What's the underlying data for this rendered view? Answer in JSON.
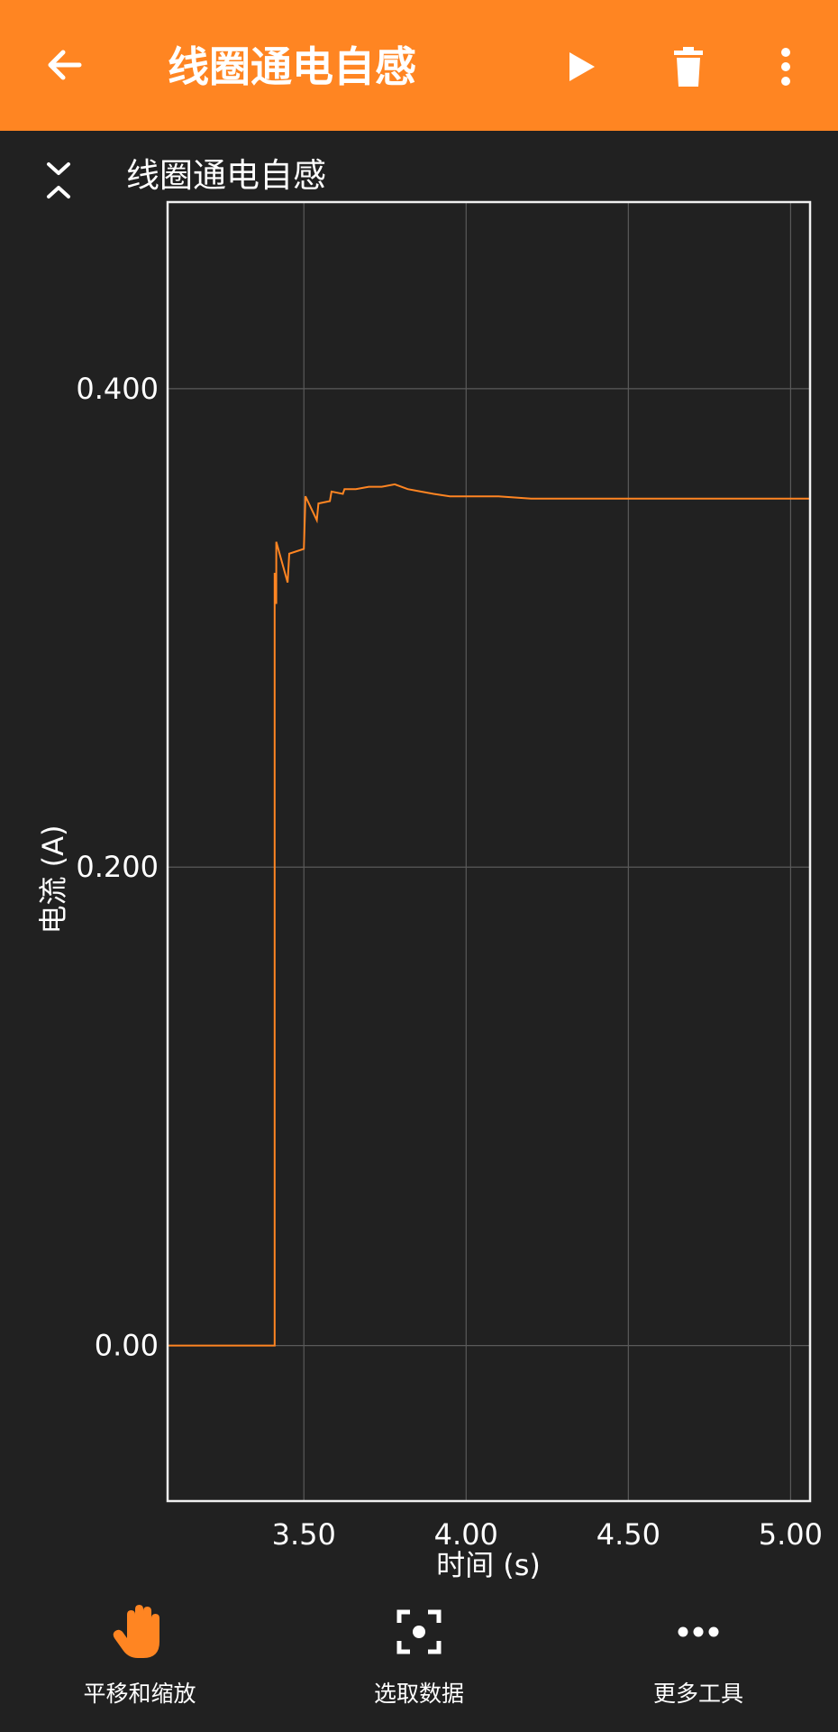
{
  "app_bar": {
    "title": "线圈通电自感",
    "back_icon": "arrow-left-icon",
    "play_icon": "play-icon",
    "delete_icon": "trash-icon",
    "more_icon": "more-vert-icon",
    "background": "#ff8522"
  },
  "graph": {
    "title": "线圈通电自感",
    "collapse_icon": "collapse-expand-icon"
  },
  "chart_data": {
    "type": "line",
    "title": "",
    "xlabel": "时间 (s)",
    "ylabel": "电流 (A)",
    "xlim": [
      3.08,
      5.06
    ],
    "ylim": [
      -0.065,
      0.478
    ],
    "x_ticks": [
      3.5,
      4.0,
      4.5,
      5.0
    ],
    "x_tick_labels": [
      "3.50",
      "4.00",
      "4.50",
      "5.00"
    ],
    "y_ticks": [
      0.0,
      0.2,
      0.4
    ],
    "y_tick_labels": [
      "0.00",
      "0.200",
      "0.400"
    ],
    "grid": true,
    "line_color": "#ff8522",
    "series": [
      {
        "x": [
          3.08,
          3.41,
          3.41,
          3.415,
          3.415,
          3.45,
          3.455,
          3.5,
          3.505,
          3.54,
          3.545,
          3.58,
          3.585,
          3.62,
          3.625,
          3.66,
          3.7,
          3.74,
          3.78,
          3.82,
          3.86,
          3.9,
          3.95,
          4.0,
          4.1,
          4.2,
          4.3,
          4.4,
          4.5,
          4.6,
          4.7,
          4.8,
          4.9,
          5.0,
          5.06
        ],
        "y": [
          0.0,
          0.0,
          0.323,
          0.31,
          0.336,
          0.319,
          0.331,
          0.333,
          0.355,
          0.345,
          0.352,
          0.353,
          0.357,
          0.356,
          0.358,
          0.358,
          0.359,
          0.359,
          0.36,
          0.358,
          0.357,
          0.356,
          0.355,
          0.355,
          0.355,
          0.354,
          0.354,
          0.354,
          0.354,
          0.354,
          0.354,
          0.354,
          0.354,
          0.354,
          0.354
        ]
      }
    ]
  },
  "tools": [
    {
      "label": "平移和缩放",
      "icon": "hand-pan-icon",
      "active": true
    },
    {
      "label": "选取数据",
      "icon": "select-data-icon",
      "active": false
    },
    {
      "label": "更多工具",
      "icon": "more-horiz-icon",
      "active": false
    }
  ]
}
